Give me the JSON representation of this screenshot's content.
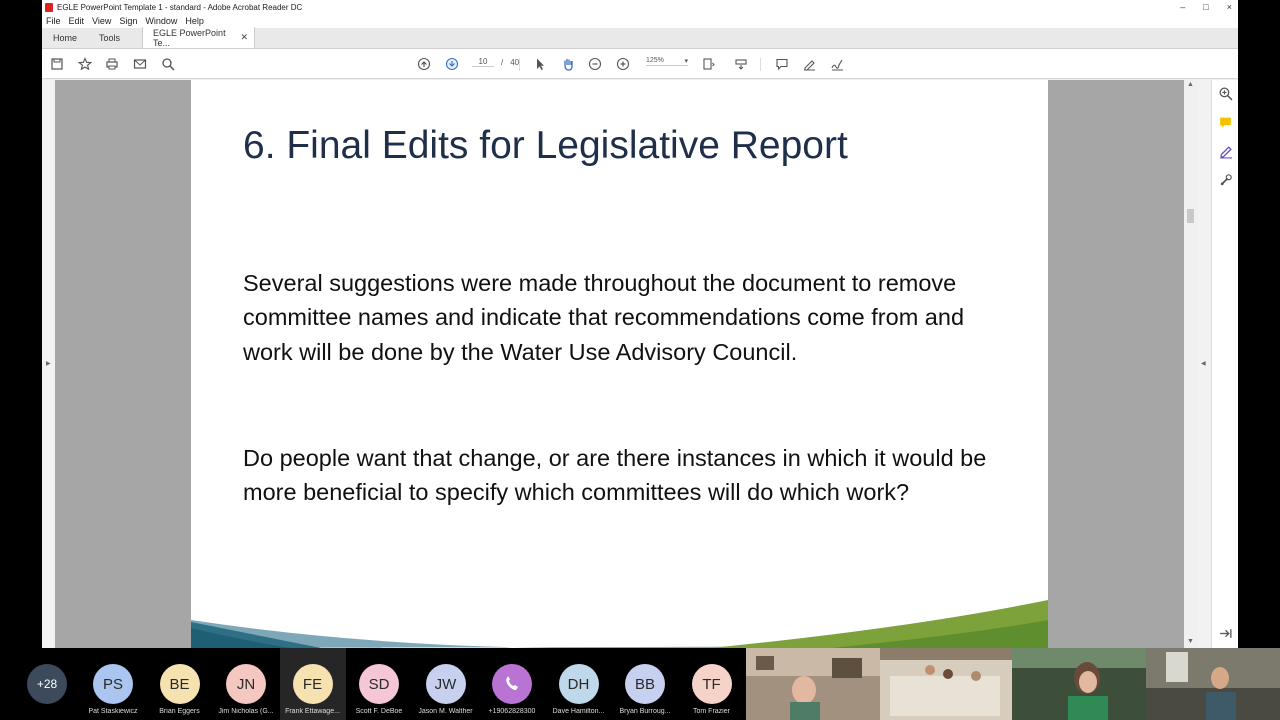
{
  "window": {
    "title": "EGLE PowerPoint Template 1 - standard - Adobe Acrobat Reader DC",
    "controls": [
      "–",
      "□",
      "×"
    ]
  },
  "menu": [
    "File",
    "Edit",
    "View",
    "Sign",
    "Window",
    "Help"
  ],
  "tabs": {
    "home": "Home",
    "tools": "Tools",
    "document": "EGLE PowerPoint Te..."
  },
  "toolbar": {
    "page_current": "10",
    "page_separator": "/",
    "page_total": "40",
    "zoom": "125%"
  },
  "slide": {
    "title": "6. Final Edits for Legislative Report",
    "paragraph1": "Several suggestions were made throughout the document to remove committee names and indicate that recommendations come from and work will be done by the Water Use Advisory Council.",
    "paragraph2": "Do people want that change, or are there instances in which it would be more beneficial to specify which committees will do which work?"
  },
  "meeting": {
    "more_count": "+28",
    "participants": [
      {
        "initials": "PS",
        "name": "Pat Staskiewicz",
        "color": "#a9c5f0"
      },
      {
        "initials": "BE",
        "name": "Brian Eggers",
        "color": "#f6e2b0"
      },
      {
        "initials": "JN",
        "name": "Jim Nicholas (G...",
        "color": "#f4c7c0"
      },
      {
        "initials": "FE",
        "name": "Frank Ettawage...",
        "color": "#f6e2b0"
      },
      {
        "initials": "SD",
        "name": "Scott F. DeBoe",
        "color": "#f4c6d6"
      },
      {
        "initials": "JW",
        "name": "Jason M. Walther",
        "color": "#c7d0ef"
      },
      {
        "initials": "",
        "name": "+19062828300",
        "color": "#b873d3"
      },
      {
        "initials": "DH",
        "name": "Dave Hamilton...",
        "color": "#bfd9ea"
      },
      {
        "initials": "BB",
        "name": "Bryan Burroug...",
        "color": "#c7d0ef"
      },
      {
        "initials": "TF",
        "name": "Tom Frazier",
        "color": "#f6d3c9"
      }
    ]
  }
}
